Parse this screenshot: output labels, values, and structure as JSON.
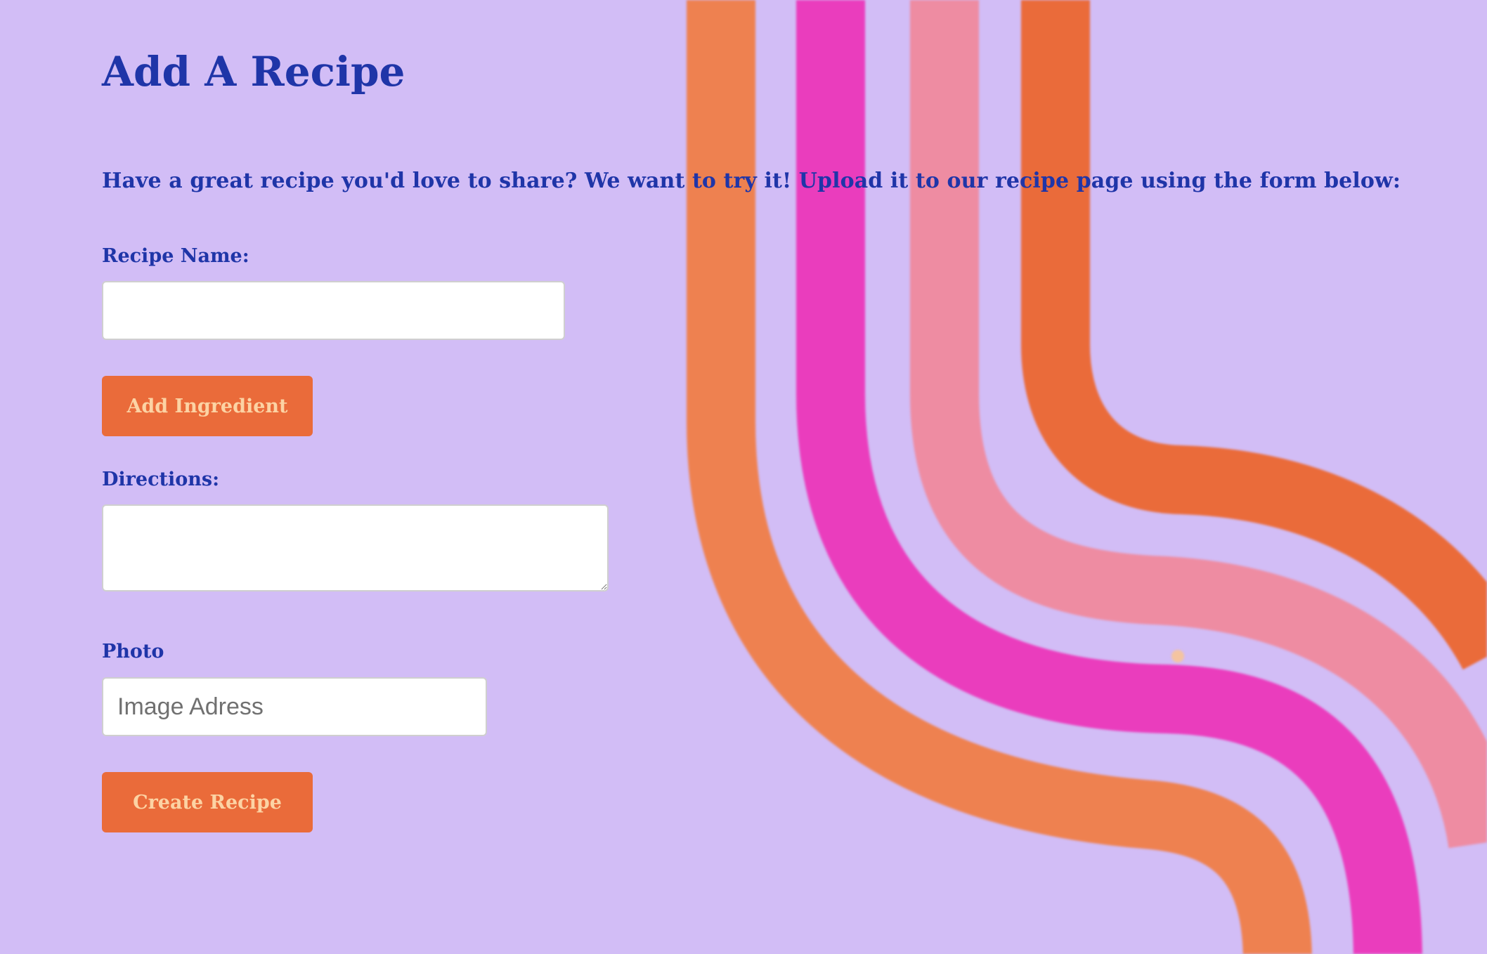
{
  "page": {
    "title": "Add A Recipe",
    "intro": "Have a great recipe you'd love to share? We want to try it! Upload it to our recipe page using the form below:"
  },
  "form": {
    "recipe_name_label": "Recipe Name:",
    "recipe_name_value": "",
    "add_ingredient_label": "Add Ingredient",
    "directions_label": "Directions:",
    "directions_value": "",
    "photo_label": "Photo",
    "photo_placeholder": "Image Adress",
    "create_recipe_label": "Create Recipe"
  },
  "colors": {
    "background": "#d2bdf6",
    "heading": "#1f35a8",
    "button": "#ea6b3a",
    "button_text": "#fcd3a4",
    "stripe_orange": "#ee8150",
    "stripe_magenta": "#ea3dbd",
    "stripe_pink": "#ee8ca2",
    "stripe_dark_orange": "#ea6b3a"
  }
}
